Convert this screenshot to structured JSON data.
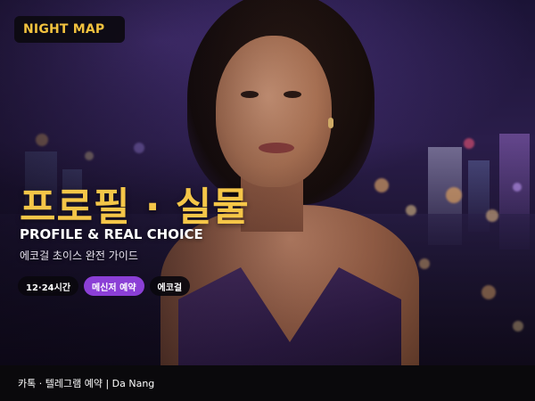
{
  "badge": {
    "label": "NIGHT MAP"
  },
  "headline": {
    "title_ko": "프로필 · 실물",
    "title_en": "PROFILE & REAL CHOICE",
    "subtitle": "에코걸 초이스 완전 가이드"
  },
  "tags": [
    {
      "label": "12·24시간"
    },
    {
      "label": "메신저 예약"
    },
    {
      "label": "에코걸"
    }
  ],
  "footer": {
    "text": "카톡 · 텔레그램 예약 | Da Nang"
  },
  "colors": {
    "accent_yellow": "#f5c648",
    "tag_purple": "#8b3fd6",
    "bar_dark": "#0a090c"
  }
}
